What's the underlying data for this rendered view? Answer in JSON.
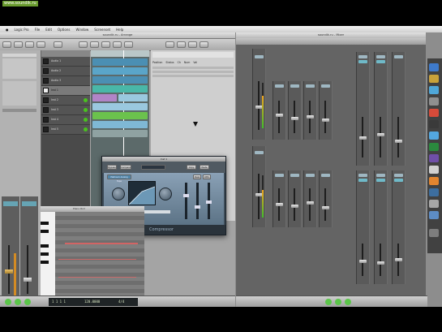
{
  "watermark": "www.soundik.ru",
  "menubar": {
    "items": [
      "Logic Pro",
      "File",
      "Edit",
      "Options",
      "Window",
      "Screenset",
      "Help"
    ]
  },
  "arrange_window": {
    "title": "soundik.ru - Arrange",
    "toolbar_labels": [
      "Inspector",
      "Preferences",
      "Settings",
      "Automation",
      "Flex",
      "Set Locators",
      "Repeat Section",
      "Crop",
      "Split by Playhead",
      "Bounce",
      "Colors",
      "Notes",
      "Lists",
      "Media"
    ],
    "tracks": [
      {
        "name": "Audio 1",
        "color": "#4b8fb3"
      },
      {
        "name": "Audio 2",
        "color": "#4b8fb3"
      },
      {
        "name": "Audio 3",
        "color": "#4b8fb3"
      },
      {
        "name": "Inst 1",
        "color": "#49b7a8"
      },
      {
        "name": "Inst 2",
        "color": "#5aa5c9"
      },
      {
        "name": "Inst 3",
        "color": "#b184c7"
      },
      {
        "name": "Inst 4",
        "color": "#6bc24d"
      },
      {
        "name": "Inst 5",
        "color": "#9ac8df"
      }
    ],
    "event_list_headers": [
      "Position",
      "Status",
      "Ch",
      "Num",
      "Val",
      "Length/Info"
    ]
  },
  "plugin_window": {
    "title": "Inst 1",
    "plugin_name": "Compressor",
    "buttons": [
      "Bypass",
      "Compare",
      "Copy",
      "Paste",
      "Manual"
    ],
    "view_buttons": [
      "Platinum Analog Tape",
      "Peak",
      "RMS"
    ]
  },
  "piano_roll": {
    "title": "Piano Roll",
    "tabs": [
      "Mixer",
      "Sample Editor",
      "Piano Roll",
      "Score",
      "Hyper Editor"
    ]
  },
  "mixer_window": {
    "title": "soundik.ru - Mixer",
    "channel_labels": [
      "Audio 1",
      "Audio 2",
      "Audio 3",
      "Inst 1",
      "Output 1-2",
      "Master"
    ]
  },
  "transport": {
    "position": "1 1 1 1",
    "tempo": "120.0000",
    "signature": "4/4"
  },
  "colors": {
    "region_blue": "#4b8fb3",
    "region_green": "#6bc24d",
    "plugin_bg": "#3d4b57",
    "accent_led": "#49c21e"
  }
}
